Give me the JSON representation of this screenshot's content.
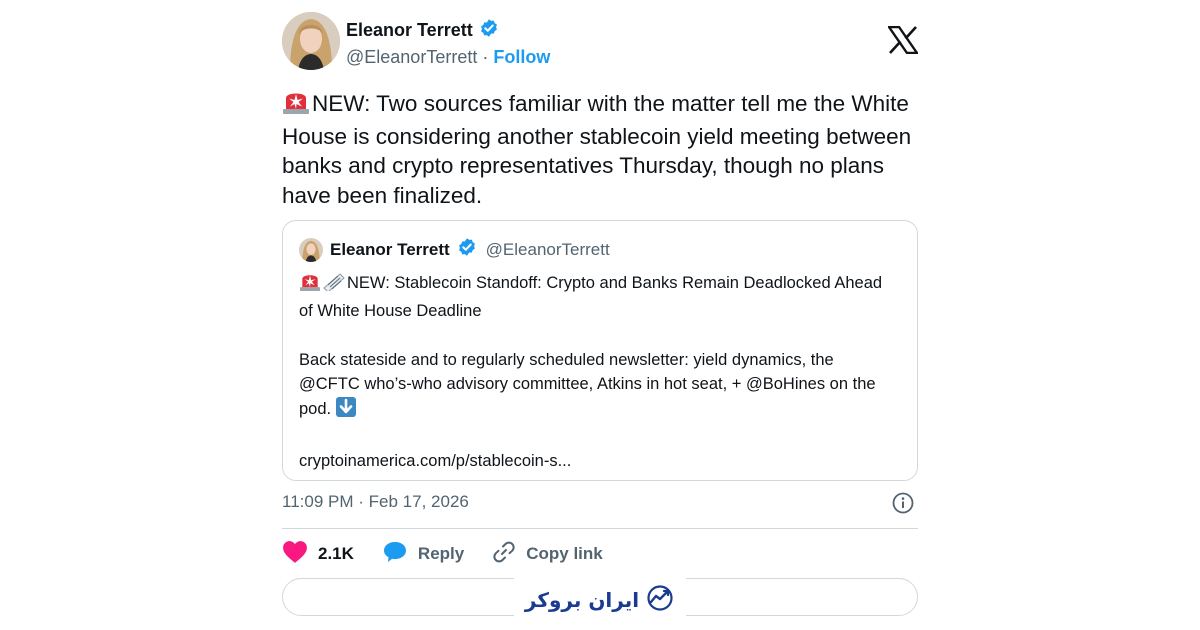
{
  "author": {
    "name": "Eleanor Terrett",
    "handle": "@EleanorTerrett",
    "separator": "·",
    "follow_label": "Follow"
  },
  "tweet": {
    "text": "NEW: Two sources familiar with the matter tell me the White House is considering another stablecoin yield meeting between banks and crypto representatives Thursday, though no plans have been finalized."
  },
  "quote": {
    "name": "Eleanor Terrett",
    "handle": "@EleanorTerrett",
    "headline": "NEW: Stablecoin Standoff: Crypto and Banks Remain Deadlocked Ahead of White House Deadline",
    "body": "Back stateside and to regularly scheduled newsletter: yield dynamics, the @CFTC who’s-who advisory committee, Atkins in hot seat, + @BoHines on the pod.",
    "link": "cryptoinamerica.com/p/stablecoin-s..."
  },
  "meta": {
    "time": "11:09 PM",
    "separator": "·",
    "date": "Feb 17, 2026"
  },
  "actions": {
    "like_count": "2.1K",
    "reply_label": "Reply",
    "copy_label": "Copy link"
  },
  "watermark": {
    "text": "ایران بروکر"
  },
  "colors": {
    "accent": "#1d9bf0",
    "like": "#f91880",
    "verified": "#1d9bf0",
    "border": "#cfd9de",
    "muted": "#536471"
  },
  "icons": {
    "verified": "verified-badge-icon",
    "x_logo": "x-logo-icon",
    "siren": "police-siren-emoji",
    "newspaper": "rolled-newspaper-emoji",
    "down_arrow": "down-arrow-emoji",
    "info": "info-icon",
    "heart": "heart-icon",
    "reply": "speech-bubble-icon",
    "link": "link-icon"
  }
}
